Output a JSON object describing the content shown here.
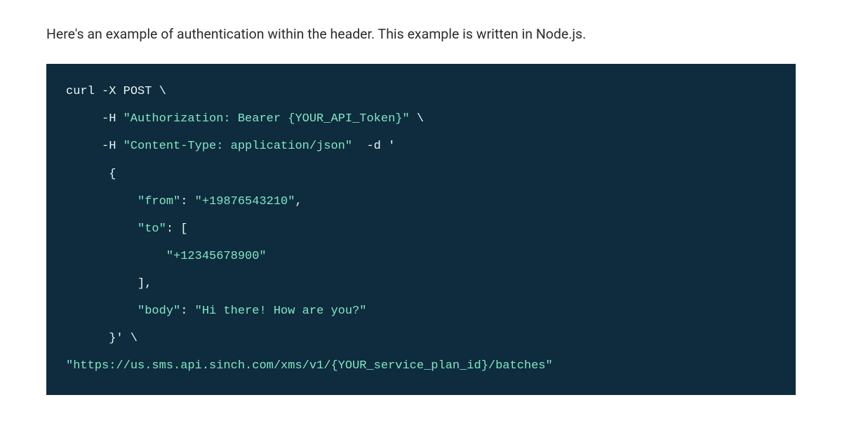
{
  "intro_text": "Here's an example of authentication within the header. This example is written in Node.js.",
  "code": {
    "line1_curl": "curl -X POST \\",
    "line2_flag": "-H ",
    "line2_header": "\"Authorization: Bearer {YOUR_API_Token}\"",
    "line2_tail": " \\",
    "line3_flag": "-H ",
    "line3_header": "\"Content-Type: application/json\"",
    "line3_mid": "  -d '",
    "line4_open": "{",
    "line5_key": "\"from\"",
    "line5_colon": ": ",
    "line5_val": "\"+19876543210\"",
    "line5_comma": ",",
    "line6_key": "\"to\"",
    "line6_colon": ": [",
    "line7_val": "\"+12345678900\"",
    "line8_close": "],",
    "line9_key": "\"body\"",
    "line9_colon": ": ",
    "line9_val": "\"Hi there! How are you?\"",
    "line10_close": "}' \\",
    "line11_url": "\"https://us.sms.api.sinch.com/xms/v1/{YOUR_service_plan_id}/batches\""
  },
  "colors": {
    "code_bg": "#0f2b3e",
    "code_string": "#7fe9c3",
    "code_plain": "#e7f6f2",
    "page_bg": "#ffffff",
    "text": "#2c2c2c"
  }
}
